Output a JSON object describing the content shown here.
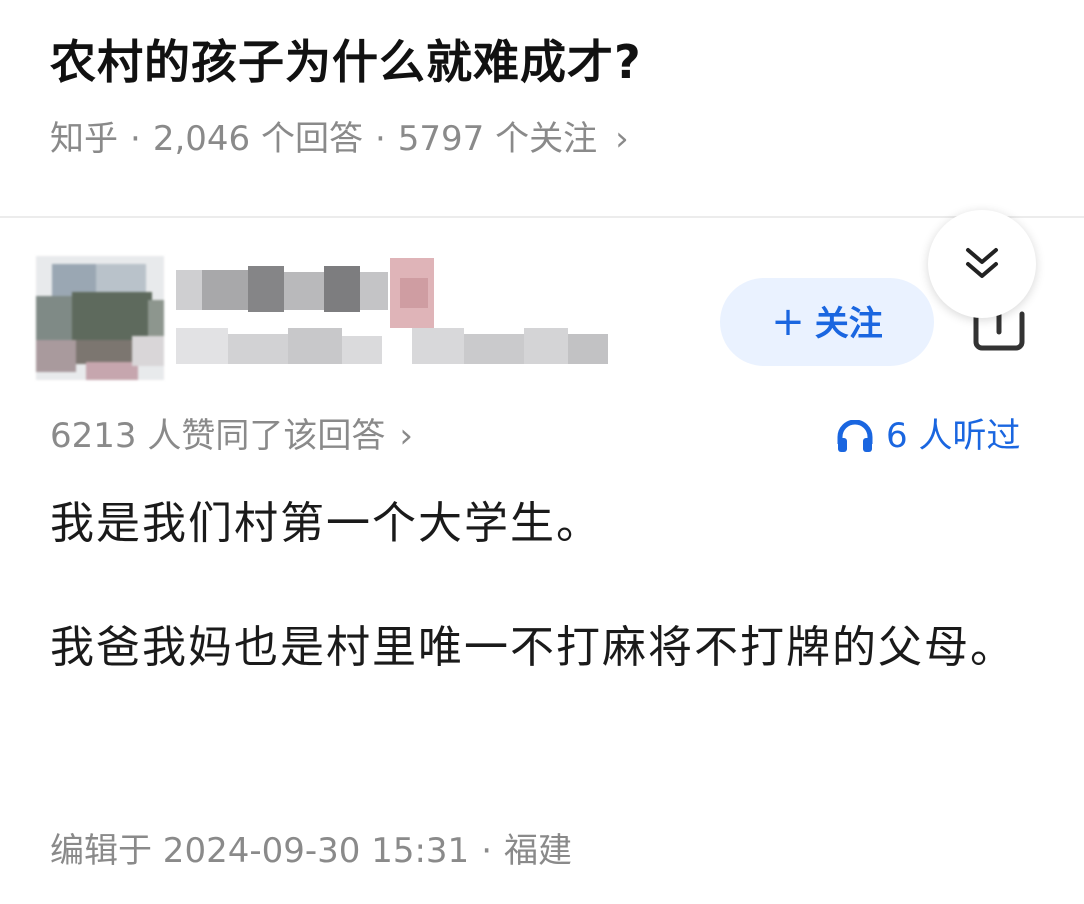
{
  "question": {
    "title": "农村的孩子为什么就难成才?",
    "source": "知乎",
    "separator": "·",
    "answer_count": "2,046 个回答",
    "follower_count": "5797 个关注",
    "chevron": "›"
  },
  "author": {
    "avatar_icon": "avatar-blurred",
    "follow_label": "关注",
    "follow_plus": "+",
    "share_icon": "share-icon",
    "collapse_icon": "double-chevron-down-icon"
  },
  "answer": {
    "votes": "6213 人赞同了该回答",
    "votes_chevron": "›",
    "listened": "6 人听过",
    "listened_icon": "headphones-icon",
    "paragraphs": [
      "我是我们村第一个大学生。",
      "我爸我妈也是村里唯一不打麻将不打牌的父母。"
    ],
    "edited": "编辑于 2024-09-30 15:31",
    "separator": "·",
    "location": "福建"
  },
  "colors": {
    "accent": "#1a66e0",
    "follow_bg": "#eaf2ff",
    "meta_text": "#8a8a8a",
    "title_text": "#111111"
  }
}
